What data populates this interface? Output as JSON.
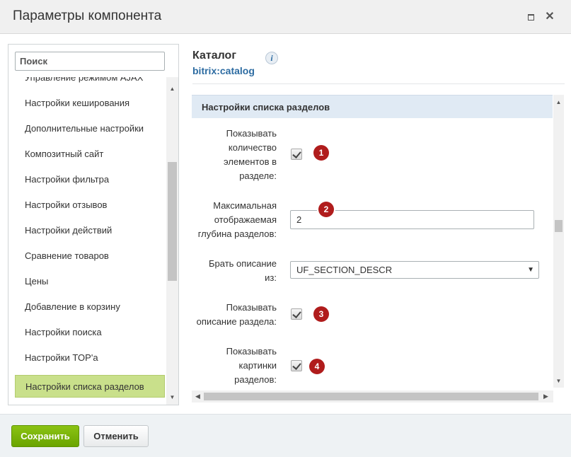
{
  "window": {
    "title": "Параметры компонента"
  },
  "sidebar": {
    "search_placeholder": "Поиск",
    "items": [
      {
        "label": "Управление режимом AJAX"
      },
      {
        "label": "Настройки кеширования"
      },
      {
        "label": "Дополнительные настройки"
      },
      {
        "label": "Композитный сайт"
      },
      {
        "label": "Настройки фильтра"
      },
      {
        "label": "Настройки отзывов"
      },
      {
        "label": "Настройки действий"
      },
      {
        "label": "Сравнение товаров"
      },
      {
        "label": "Цены"
      },
      {
        "label": "Добавление в корзину"
      },
      {
        "label": "Настройки поиска"
      },
      {
        "label": "Настройки TOP'а"
      },
      {
        "label": "Настройки списка разделов",
        "active": true
      }
    ]
  },
  "main": {
    "title": "Каталог",
    "subtitle": "bitrix:catalog",
    "info_icon": "i",
    "section_title": "Настройки списка разделов",
    "fields": {
      "show_count": {
        "label_lines": [
          "Показывать",
          "количество",
          "элементов в",
          "разделе:"
        ],
        "checked": true,
        "badge": "1"
      },
      "max_depth": {
        "label_lines": [
          "Максимальная",
          "отображаемая",
          "глубина разделов:"
        ],
        "value": "2",
        "badge": "2"
      },
      "description_source": {
        "label_lines": [
          "Брать описание",
          "из:"
        ],
        "selected": "UF_SECTION_DESCR"
      },
      "show_description": {
        "label_lines": [
          "Показывать",
          "описание раздела:"
        ],
        "checked": true,
        "badge": "3"
      },
      "show_pictures": {
        "label_lines": [
          "Показывать",
          "картинки",
          "разделов:"
        ],
        "checked": true,
        "badge": "4"
      }
    }
  },
  "footer": {
    "save_label": "Сохранить",
    "cancel_label": "Отменить"
  },
  "colors": {
    "save_button": "#6aa400",
    "active_item": "#c9e08b",
    "section_header": "#e0eaf4",
    "badge": "#b01c1c",
    "link": "#2d6ca2"
  }
}
